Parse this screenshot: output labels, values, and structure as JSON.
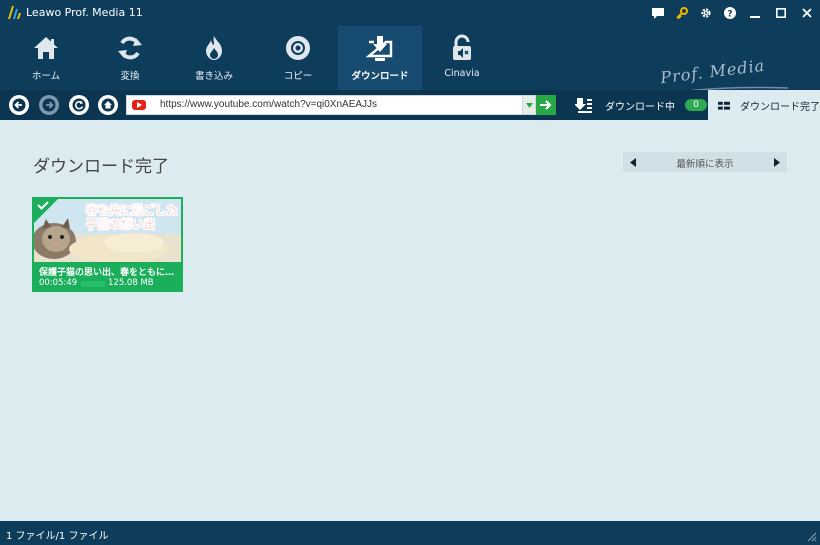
{
  "app": {
    "title": "Leawo Prof. Media 11"
  },
  "window_controls": [
    "feedback-icon",
    "key-icon",
    "gear-icon",
    "help-icon",
    "minimize-icon",
    "maximize-icon",
    "close-icon"
  ],
  "toolbar": {
    "items": [
      {
        "label": "ホーム",
        "icon": "home-icon"
      },
      {
        "label": "変換",
        "icon": "convert-icon"
      },
      {
        "label": "書き込み",
        "icon": "burn-icon"
      },
      {
        "label": "コピー",
        "icon": "disc-copy-icon"
      },
      {
        "label": "ダウンロード",
        "icon": "download-icon",
        "active": true
      },
      {
        "label": "Cinavia",
        "icon": "cinavia-icon"
      }
    ],
    "brand": "Prof. Media"
  },
  "nav": {
    "url": "https://www.youtube.com/watch?v=qi0XnAEAJJs",
    "downloading_label": "ダウンロード中",
    "downloading_count": "0",
    "completed_label": "ダウンロード完了"
  },
  "content": {
    "title": "ダウンロード完了",
    "sort_label": "最新順に表示",
    "items": [
      {
        "thumb_text_line1": "春を共に過ごした",
        "thumb_text_line2": "子猫の想い出",
        "title": "保護子猫の思い出、春をともに…",
        "duration": "00:05:49",
        "size": "125.08 MB"
      }
    ]
  },
  "status": {
    "text": "1 ファイル/1 ファイル"
  },
  "colors": {
    "header": "#0e3d5c",
    "background": "#dcebef",
    "accent_green": "#1bae5b"
  }
}
